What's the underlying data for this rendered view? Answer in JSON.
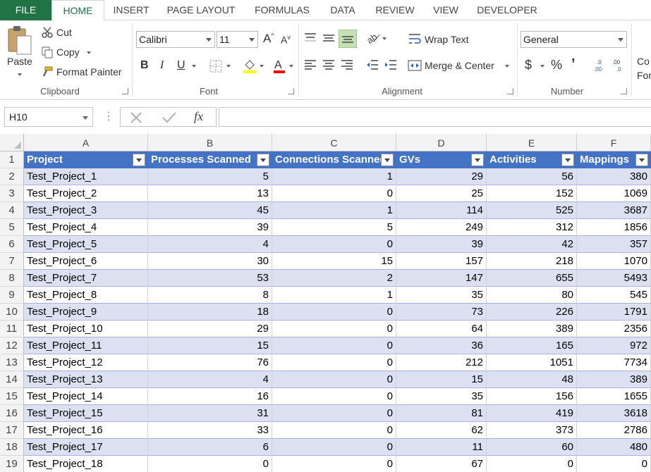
{
  "tabs": [
    "FILE",
    "HOME",
    "INSERT",
    "PAGE LAYOUT",
    "FORMULAS",
    "DATA",
    "REVIEW",
    "VIEW",
    "DEVELOPER"
  ],
  "active_tab": "HOME",
  "ribbon": {
    "clipboard": {
      "paste": "Paste",
      "cut": "Cut",
      "copy": "Copy",
      "format_painter": "Format Painter",
      "label": "Clipboard"
    },
    "font": {
      "name": "Calibri",
      "size": "11",
      "bold": "B",
      "italic": "I",
      "underline": "U",
      "label": "Font"
    },
    "alignment": {
      "wrap_text": "Wrap Text",
      "merge_center": "Merge & Center",
      "label": "Alignment"
    },
    "number": {
      "format": "General",
      "currency": "$",
      "percent": "%",
      "comma": "’",
      "label": "Number"
    },
    "conditional_partial_1": "Co",
    "conditional_partial_2": "For"
  },
  "formula_bar": {
    "name_box": "H10",
    "fx": "fx",
    "formula": ""
  },
  "columns": [
    "A",
    "B",
    "C",
    "D",
    "E",
    "F"
  ],
  "table_headers": [
    "Project",
    "Processes Scanned",
    "Connections Scanned",
    "GVs",
    "Activities",
    "Mappings"
  ],
  "row_numbers": [
    "1",
    "2",
    "3",
    "4",
    "5",
    "6",
    "7",
    "8",
    "9",
    "10",
    "11",
    "12",
    "13",
    "14",
    "15",
    "16",
    "17",
    "18",
    "19"
  ],
  "rows": [
    [
      "Test_Project_1",
      "5",
      "1",
      "29",
      "56",
      "380"
    ],
    [
      "Test_Project_2",
      "13",
      "0",
      "25",
      "152",
      "1069"
    ],
    [
      "Test_Project_3",
      "45",
      "1",
      "114",
      "525",
      "3687"
    ],
    [
      "Test_Project_4",
      "39",
      "5",
      "249",
      "312",
      "1856"
    ],
    [
      "Test_Project_5",
      "4",
      "0",
      "39",
      "42",
      "357"
    ],
    [
      "Test_Project_6",
      "30",
      "15",
      "157",
      "218",
      "1070"
    ],
    [
      "Test_Project_7",
      "53",
      "2",
      "147",
      "655",
      "5493"
    ],
    [
      "Test_Project_8",
      "8",
      "1",
      "35",
      "80",
      "545"
    ],
    [
      "Test_Project_9",
      "18",
      "0",
      "73",
      "226",
      "1791"
    ],
    [
      "Test_Project_10",
      "29",
      "0",
      "64",
      "389",
      "2356"
    ],
    [
      "Test_Project_11",
      "15",
      "0",
      "36",
      "165",
      "972"
    ],
    [
      "Test_Project_12",
      "76",
      "0",
      "212",
      "1051",
      "7734"
    ],
    [
      "Test_Project_13",
      "4",
      "0",
      "15",
      "48",
      "389"
    ],
    [
      "Test_Project_14",
      "16",
      "0",
      "35",
      "156",
      "1655"
    ],
    [
      "Test_Project_15",
      "31",
      "0",
      "81",
      "419",
      "3618"
    ],
    [
      "Test_Project_16",
      "33",
      "0",
      "62",
      "373",
      "2786"
    ],
    [
      "Test_Project_17",
      "6",
      "0",
      "11",
      "60",
      "480"
    ],
    [
      "Test_Project_18",
      "0",
      "0",
      "67",
      "0",
      "0"
    ]
  ],
  "colors": {
    "brand": "#217346",
    "table_header": "#4472c4",
    "band": "#dce1f2",
    "selected_align": "#c6e0b4"
  }
}
